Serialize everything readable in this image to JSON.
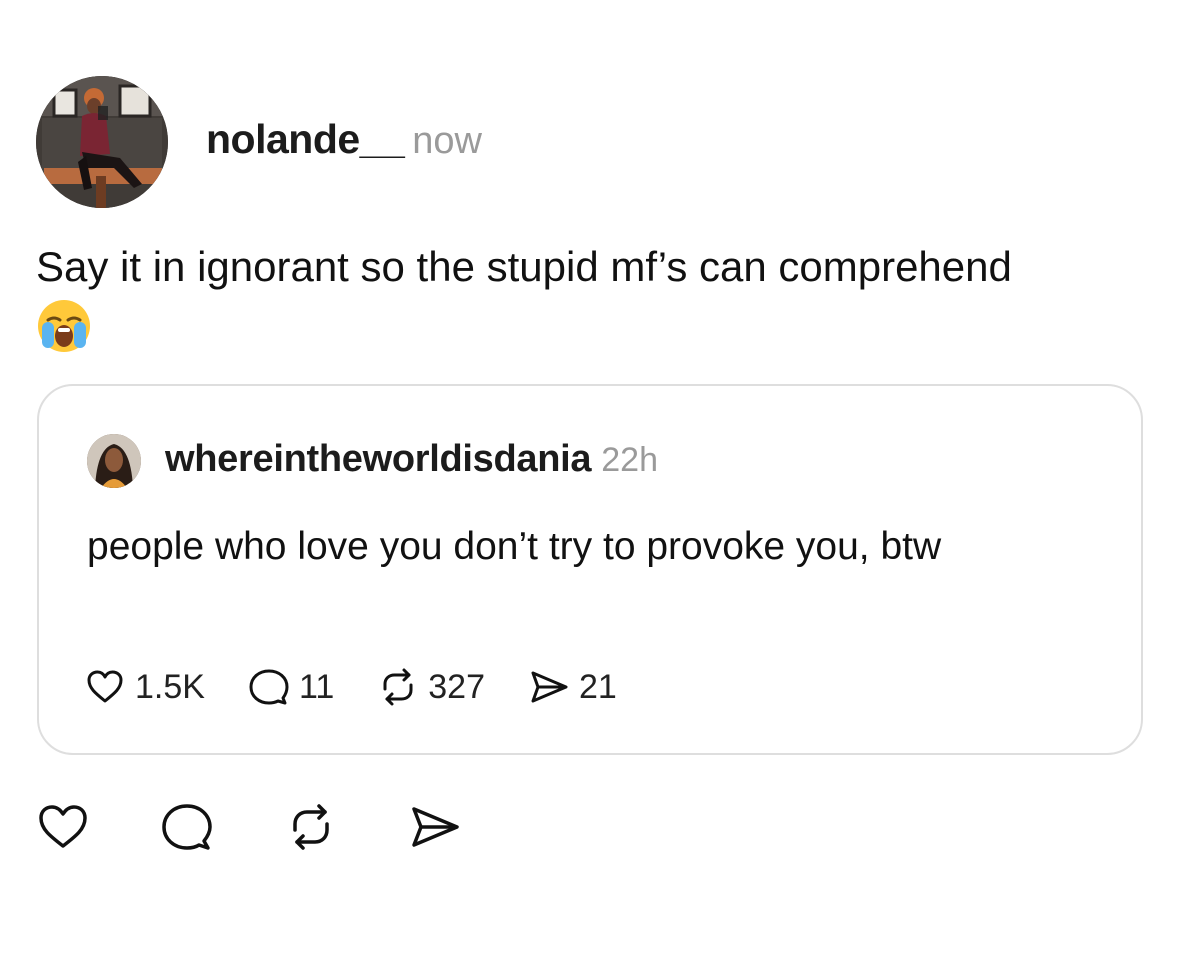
{
  "post": {
    "author": "nolande__",
    "time": "now",
    "text": "Say it in ignorant so the stupid mf’s can comprehend",
    "emoji": "loudly-crying-face"
  },
  "quote": {
    "author": "whereintheworldisdania",
    "time": "22h",
    "text": "people who love you don’t try to provoke you, btw",
    "stats": {
      "likes": "1.5K",
      "replies": "11",
      "reposts": "327",
      "shares": "21"
    }
  },
  "actions": {
    "icons": [
      "heart-icon",
      "comment-icon",
      "repost-icon",
      "share-icon"
    ]
  },
  "colors": {
    "text": "#101010",
    "muted": "#9a9a9a",
    "border": "#dedede"
  }
}
